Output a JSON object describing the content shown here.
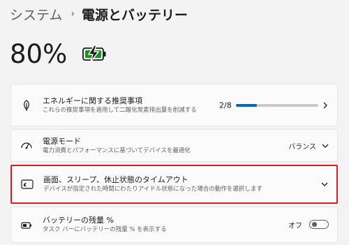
{
  "breadcrumb": {
    "parent": "システム",
    "separator": "›",
    "current": "電源とバッテリー"
  },
  "battery": {
    "percent_text": "80%",
    "level": 0.8,
    "icon": "battery-charging-icon",
    "colors": {
      "fill": "#1f8f2a",
      "outline": "#1b1b1b",
      "bolt": "#1b1b1b"
    }
  },
  "cards": {
    "energy": {
      "icon": "leaf-icon",
      "title": "エネルギーに関する推奨事項",
      "subtitle": "これらの推奨事項を適用して二酸化炭素排出量を削減する",
      "progress_text": "2/8",
      "progress_fraction": 0.25,
      "chevron": "chevron-right-icon"
    },
    "power_mode": {
      "icon": "gauge-icon",
      "title": "電源モード",
      "subtitle": "電力消費とパフォーマンスに基づいてデバイスを最適化",
      "value": "バランス",
      "chevron": "chevron-down-icon"
    },
    "screen_sleep": {
      "icon": "screen-sleep-icon",
      "title": "画面、スリープ、休止状態のタイムアウト",
      "subtitle": "デバイスが指定された時間にわたりアイドル状態になった場合の動作を選択します",
      "chevron": "chevron-down-icon"
    },
    "battery_pct": {
      "icon": "battery-percent-icon",
      "title": "バッテリーの残量 %",
      "subtitle": "タスク バーにバッテリーの残量 % を表示する",
      "toggle_label": "オフ",
      "toggle_on": false
    }
  },
  "colors": {
    "accent": "#0067c0",
    "highlight_border": "#d0202b",
    "background": "#f3f3f3",
    "card": "#fbfbfb"
  }
}
